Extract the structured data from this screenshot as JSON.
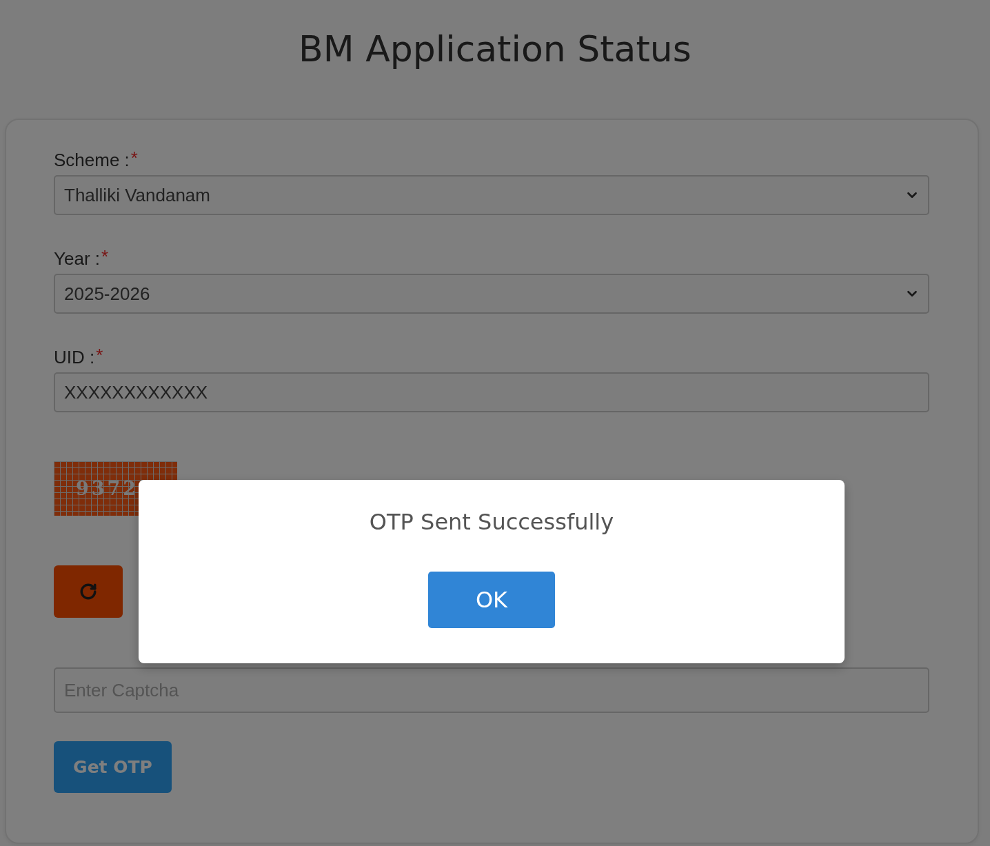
{
  "page": {
    "title": "BM Application Status"
  },
  "form": {
    "fields": [
      {
        "kind": "select",
        "label": "Scheme :",
        "required_mark": "*",
        "value": "Thalliki Vandanam"
      },
      {
        "kind": "select",
        "label": "Year :",
        "required_mark": "*",
        "value": "2025-2026"
      },
      {
        "kind": "text",
        "label": "UID :",
        "required_mark": "*",
        "value": "XXXXXXXXXXXX"
      }
    ],
    "captcha": {
      "text": "9372"
    },
    "captcha_input": {
      "placeholder": "Enter Captcha"
    },
    "submit_button": "Get OTP"
  },
  "dialog": {
    "message": "OTP Sent Successfully",
    "button": "OK"
  }
}
